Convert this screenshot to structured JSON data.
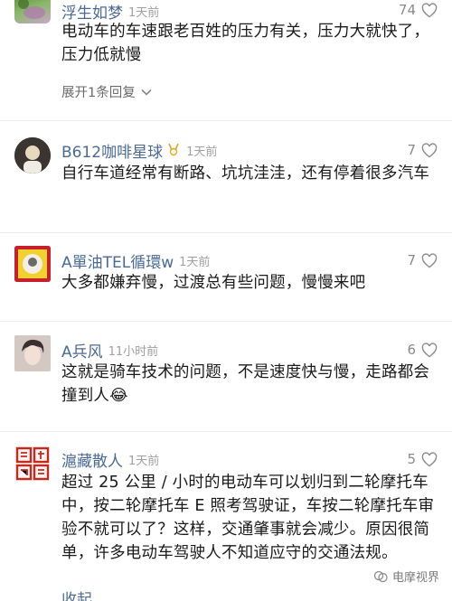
{
  "comments": [
    {
      "user": "浮生如梦",
      "time": "1天前",
      "likes": "74",
      "text": "电动车的车速跟老百姓的压力有关，压力大就快了，压力低就慢",
      "expand": "展开1条回复"
    },
    {
      "user": "B612咖啡星球",
      "time": "1天前",
      "likes": "7",
      "text": "自行车道经常有断路、坑坑洼洼，还有停着很多汽车"
    },
    {
      "user": "A單油TEL循環w",
      "time": "1天前",
      "likes": "7",
      "text": "大多都嫌弃慢，过渡总有些问题，慢慢来吧"
    },
    {
      "user": "A兵风",
      "time": "11小时前",
      "likes": "6",
      "text": "这就是骑车技术的问题，不是速度快与慢，走路都会撞到人😂"
    },
    {
      "user": "滬藏散人",
      "time": "1天前",
      "likes": "5",
      "text": "超过 25 公里 / 小时的电动车可以划归到二轮摩托车中，按二轮摩托车 E 照考驾驶证，车按二轮摩托车审验不就可以了？这样，交通肇事就会减少。原因很简单，许多电动车驾驶人不知道应守的交通法规。",
      "collapse": "收起"
    }
  ],
  "badge_icon": "medal-icon",
  "watermark": "电摩视界",
  "colors": {
    "username": "#4a6a96",
    "meta": "#a0a0a0",
    "text": "#1a1a1a"
  }
}
